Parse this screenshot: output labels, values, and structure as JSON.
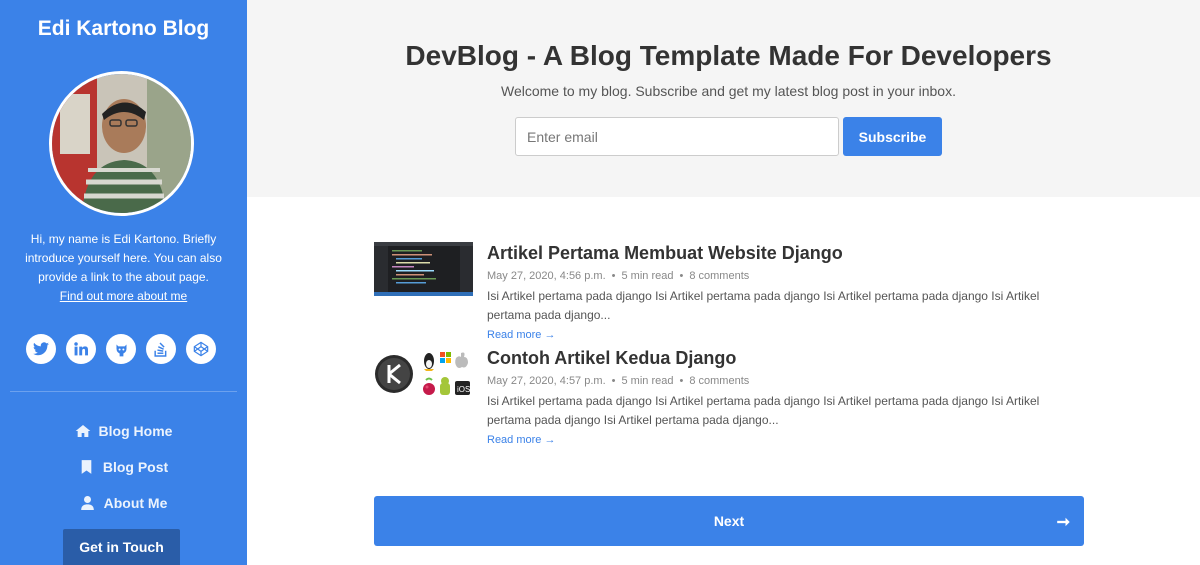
{
  "sidebar": {
    "site_title": "Edi Kartono Blog",
    "bio": "Hi, my name is Edi Kartono. Briefly introduce yourself here. You can also provide a link to the about page.",
    "bio_link": "Find out more about me",
    "socials": [
      "twitter-icon",
      "linkedin-icon",
      "github-icon",
      "stack-overflow-icon",
      "codepen-icon"
    ],
    "nav": [
      {
        "icon": "home-icon",
        "label": "Blog Home"
      },
      {
        "icon": "bookmark-icon",
        "label": "Blog Post"
      },
      {
        "icon": "user-icon",
        "label": "About Me"
      }
    ],
    "cta_label": "Get in Touch"
  },
  "hero": {
    "title": "DevBlog - A Blog Template Made For Developers",
    "subtitle": "Welcome to my blog. Subscribe and get my latest blog post in your inbox.",
    "email_placeholder": "Enter email",
    "subscribe_label": "Subscribe"
  },
  "posts": [
    {
      "title": "Artikel Pertama Membuat Website Django",
      "date": "May 27, 2020, 4:56 p.m.",
      "read_time": "5 min read",
      "comments": "8 comments",
      "excerpt": "Isi Artikel pertama pada django Isi Artikel pertama pada django Isi Artikel pertama pada django Isi Artikel pertama pada django...",
      "read_more": "Read more →"
    },
    {
      "title": "Contoh Artikel Kedua Django",
      "date": "May 27, 2020, 4:57 p.m.",
      "read_time": "5 min read",
      "comments": "8 comments",
      "excerpt": "Isi Artikel pertama pada django Isi Artikel pertama pada django Isi Artikel pertama pada django Isi Artikel pertama pada django Isi Artikel pertama pada django...",
      "read_more": "Read more →"
    }
  ],
  "pagination": {
    "next_label": "Next",
    "next_arrow": "➞"
  },
  "colors": {
    "accent": "#3b82e8",
    "cta_dark": "#2a5da8",
    "hero_bg": "#f5f5f5"
  }
}
